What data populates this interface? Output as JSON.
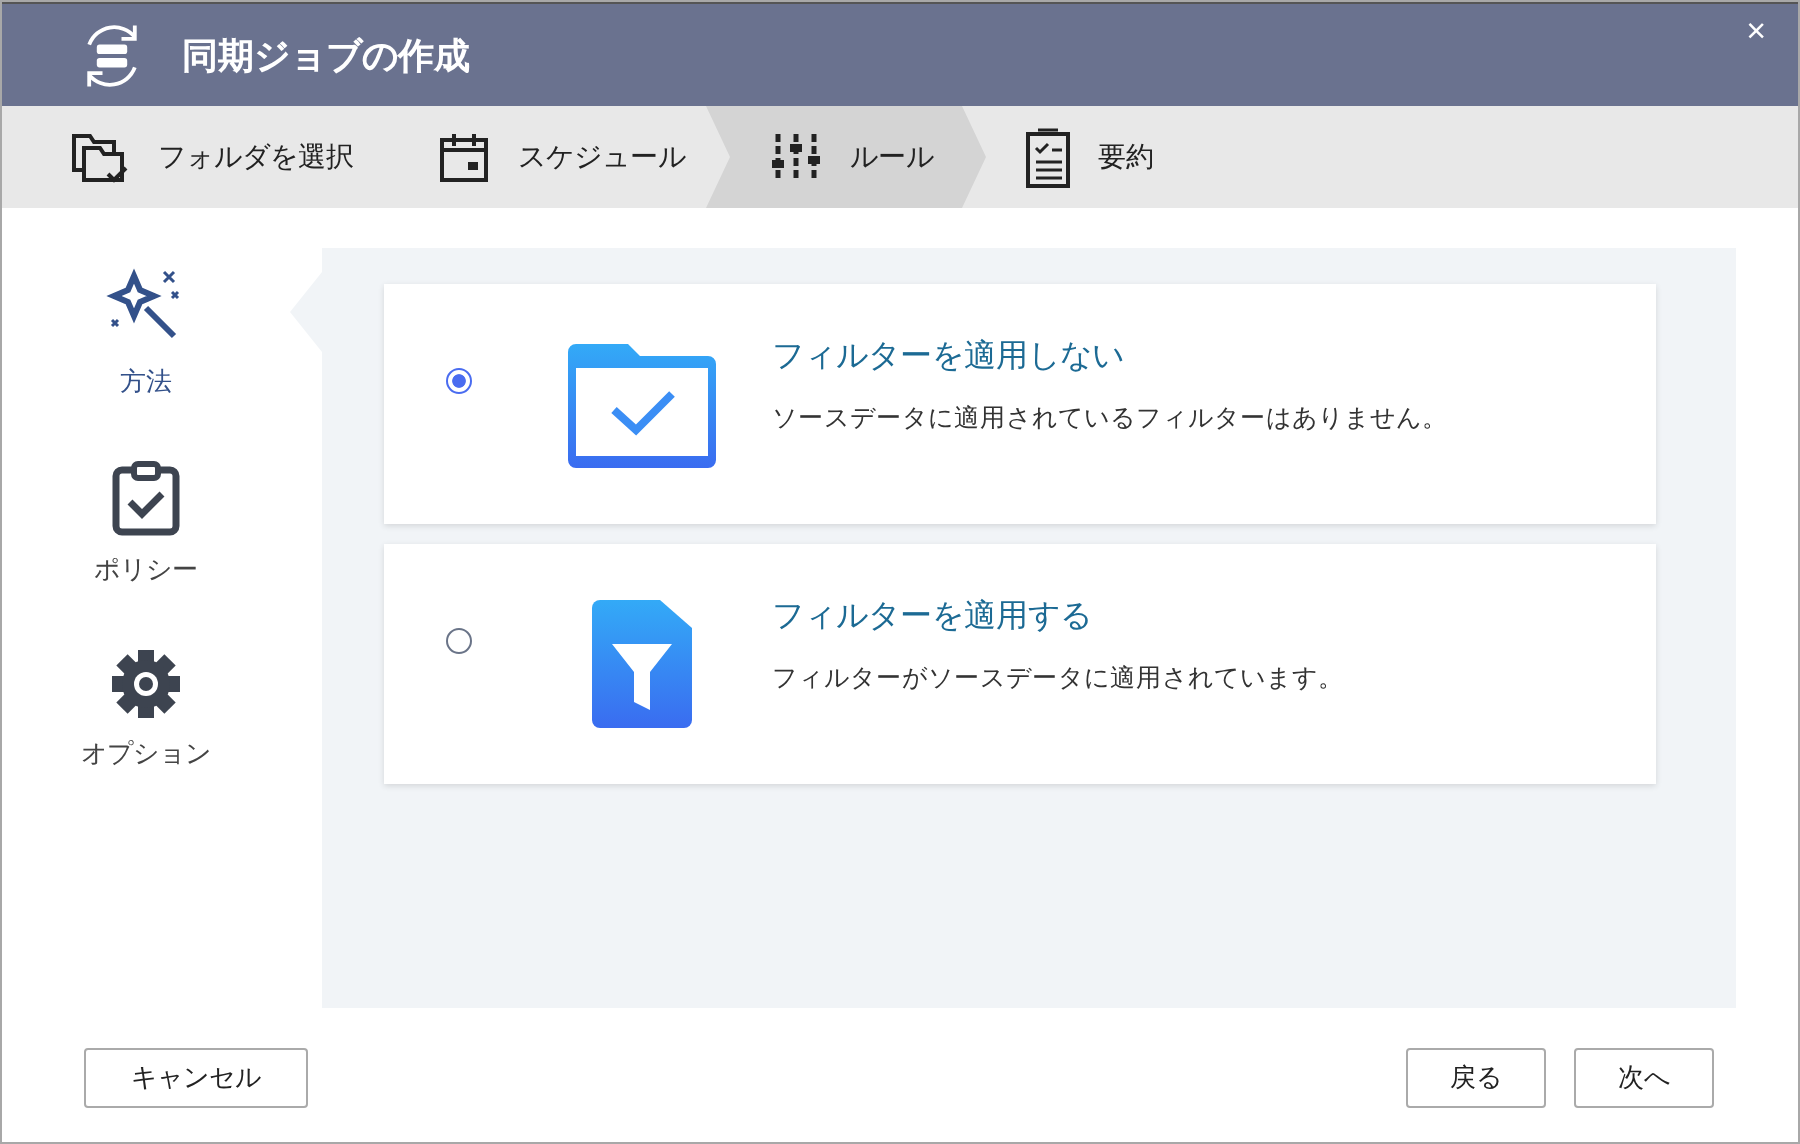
{
  "window": {
    "title": "同期ジョブの作成",
    "close": "×"
  },
  "steps": [
    {
      "kind": "folder",
      "label": "フォルダを選択",
      "selected": false
    },
    {
      "kind": "calendar",
      "label": "スケジュール",
      "selected": false
    },
    {
      "kind": "sliders",
      "label": "ルール",
      "selected": true
    },
    {
      "kind": "summary",
      "label": "要約",
      "selected": false
    }
  ],
  "sidebar": {
    "items": [
      {
        "kind": "wand",
        "label": "方法",
        "selected": true
      },
      {
        "kind": "clipboard",
        "label": "ポリシー",
        "selected": false
      },
      {
        "kind": "gear",
        "label": "オプション",
        "selected": false
      }
    ]
  },
  "options": [
    {
      "kind": "folder",
      "title": "フィルターを適用しない",
      "description": "ソースデータに適用されているフィルターはありません。",
      "selected": true
    },
    {
      "kind": "filter",
      "title": "フィルターを適用する",
      "description": "フィルターがソースデータに適用されています。",
      "selected": false
    }
  ],
  "buttons": {
    "cancel": "キャンセル",
    "back": "戻る",
    "next": "次へ"
  }
}
